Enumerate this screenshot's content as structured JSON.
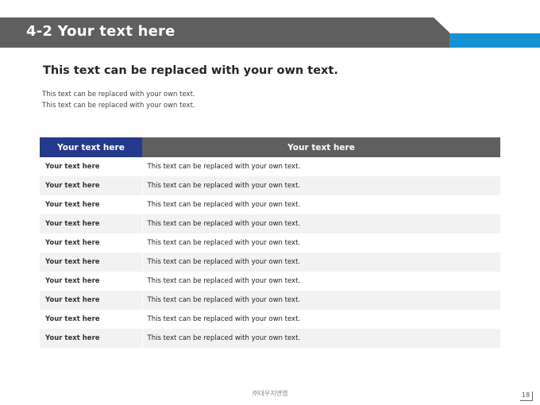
{
  "slide": {
    "title": "4-2 Your text here",
    "heading": "This text can be replaced with your own text.",
    "desc": [
      "This text can be replaced with your own text.",
      "This text can be replaced with your own text."
    ],
    "footer": "㈜대우지앤엠",
    "page_number": "18"
  },
  "table": {
    "headers": [
      "Your text here",
      "Your text here"
    ],
    "rows": [
      [
        "Your text here",
        "This text can be replaced with your own text."
      ],
      [
        "Your text here",
        "This text can be replaced with your own text."
      ],
      [
        "Your text here",
        "This text can be replaced with your own text."
      ],
      [
        "Your text here",
        "This text can be replaced with your own text."
      ],
      [
        "Your text here",
        "This text can be replaced with your own text."
      ],
      [
        "Your text here",
        "This text can be replaced with your own text."
      ],
      [
        "Your text here",
        "This text can be replaced with your own text."
      ],
      [
        "Your text here",
        "This text can be replaced with your own text."
      ],
      [
        "Your text here",
        "This text can be replaced with your own text."
      ],
      [
        "Your text here",
        "This text can be replaced with your own text."
      ]
    ]
  },
  "colors": {
    "title_band": "#5f5f5f",
    "accent": "#1592d3",
    "header_col1": "#253a8c",
    "header_col2": "#5f5f5f",
    "stripe": "#f2f2f2"
  }
}
